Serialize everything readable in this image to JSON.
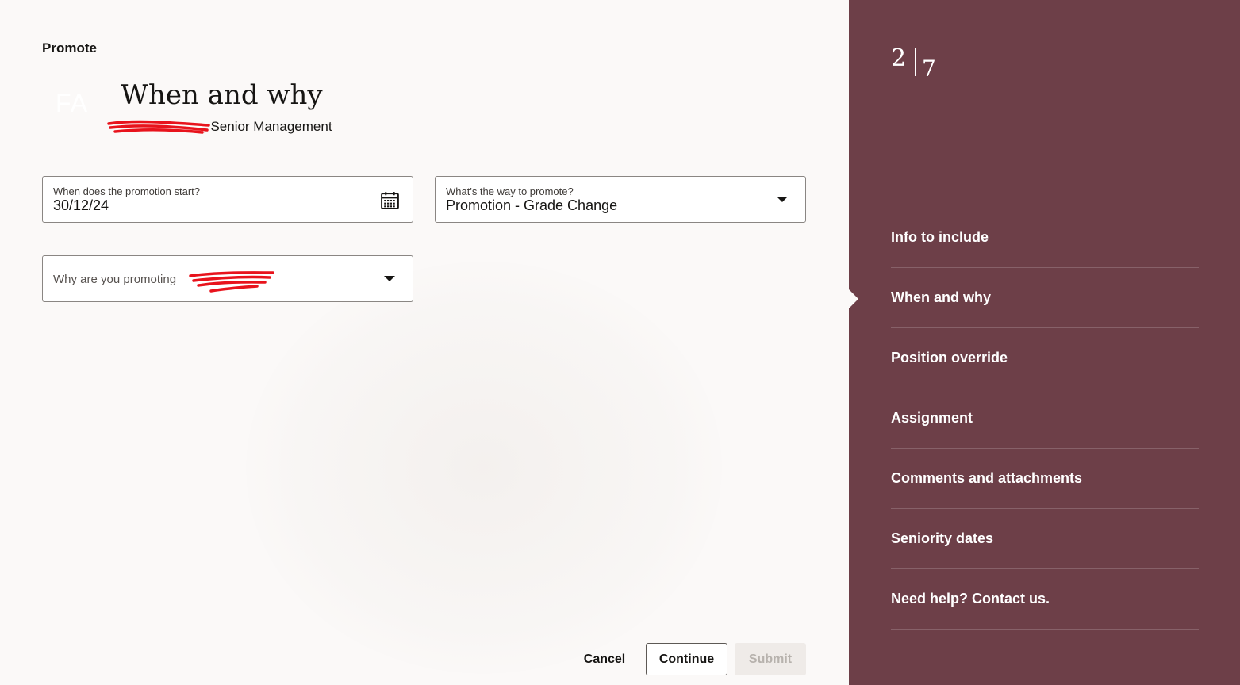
{
  "header": {
    "flow_title": "Promote",
    "avatar_initials": "FA",
    "page_title": "When and why",
    "subject_suffix": ", Senior Management"
  },
  "form": {
    "start_date": {
      "label": "When does the promotion start?",
      "value": "30/12/24",
      "icon": "calendar-icon"
    },
    "promotion_way": {
      "label": "What's the way to promote?",
      "value": "Promotion - Grade Change",
      "icon": "chevron-down-icon"
    },
    "promotion_reason": {
      "placeholder": "Why are you promoting",
      "icon": "chevron-down-icon"
    }
  },
  "actions": {
    "cancel_label": "Cancel",
    "continue_label": "Continue",
    "submit_label": "Submit"
  },
  "sidebar": {
    "current_step": "2",
    "total_steps": "7",
    "steps": [
      {
        "label": "Info to include"
      },
      {
        "label": "When and why"
      },
      {
        "label": "Position override"
      },
      {
        "label": "Assignment"
      },
      {
        "label": "Comments and attachments"
      },
      {
        "label": "Seniority dates"
      },
      {
        "label": "Need help? Contact us."
      }
    ]
  },
  "colors": {
    "sidebar_bg": "#6d3f48",
    "page_bg": "#fbf9f8",
    "redaction": "#e8131c"
  }
}
